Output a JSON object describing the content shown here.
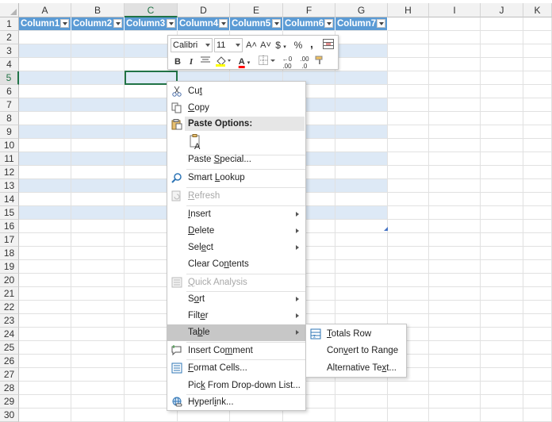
{
  "columns": [
    "A",
    "B",
    "C",
    "D",
    "E",
    "F",
    "G",
    "H",
    "I",
    "J",
    "K"
  ],
  "active_column": "C",
  "rows": [
    "1",
    "2",
    "3",
    "4",
    "5",
    "6",
    "7",
    "8",
    "9",
    "10",
    "11",
    "12",
    "13",
    "14",
    "15",
    "16",
    "17",
    "18",
    "19",
    "20",
    "21",
    "22",
    "23",
    "24",
    "25",
    "26",
    "27",
    "28",
    "29",
    "30"
  ],
  "active_row": "5",
  "table_headers": [
    "Column1",
    "Column2",
    "Column3",
    "Column4",
    "Column5",
    "Column6",
    "Column7"
  ],
  "colors": {
    "header_blue": "#5b9bd5",
    "band_blue": "#dde9f6",
    "select_green": "#217346",
    "font_red": "#ff0000",
    "highlight_yellow": "#ffff00"
  },
  "mini_toolbar": {
    "font": "Calibri",
    "size": "11",
    "grow_font": "A˄",
    "shrink_font": "A˅",
    "currency": "$",
    "percent": "%",
    "comma": ",",
    "bold": "B",
    "italic": "I",
    "font_color_letter": "A",
    "increase_decimal": ".00",
    "decrease_decimal": ".0"
  },
  "context_menu": {
    "cut": {
      "pre": "Cu",
      "acc": "t",
      "post": ""
    },
    "copy": {
      "pre": "",
      "acc": "C",
      "post": "opy"
    },
    "paste_options": "Paste Options:",
    "paste_special": {
      "pre": "Paste ",
      "acc": "S",
      "post": "pecial..."
    },
    "smart_lookup": {
      "pre": "Smart ",
      "acc": "L",
      "post": "ookup"
    },
    "refresh": {
      "pre": "",
      "acc": "R",
      "post": "efresh"
    },
    "insert": {
      "pre": "",
      "acc": "I",
      "post": "nsert"
    },
    "delete": {
      "pre": "",
      "acc": "D",
      "post": "elete"
    },
    "select": {
      "pre": "Sel",
      "acc": "e",
      "post": "ct"
    },
    "clear_contents": {
      "pre": "Clear Co",
      "acc": "n",
      "post": "tents"
    },
    "quick_analysis": {
      "pre": "",
      "acc": "Q",
      "post": "uick Analysis"
    },
    "sort": {
      "pre": "S",
      "acc": "o",
      "post": "rt"
    },
    "filter": {
      "pre": "Filt",
      "acc": "e",
      "post": "r"
    },
    "table": {
      "pre": "Ta",
      "acc": "b",
      "post": "le"
    },
    "insert_comment": {
      "pre": "Insert Co",
      "acc": "m",
      "post": "ment"
    },
    "format_cells": {
      "pre": "",
      "acc": "F",
      "post": "ormat Cells..."
    },
    "pick_list": {
      "pre": "Pic",
      "acc": "k",
      "post": " From Drop-down List..."
    },
    "hyperlink": {
      "pre": "Hyperl",
      "acc": "i",
      "post": "nk..."
    }
  },
  "submenu": {
    "totals_row": {
      "pre": "",
      "acc": "T",
      "post": "otals Row"
    },
    "convert_to_range": {
      "pre": "Con",
      "acc": "v",
      "post": "ert to Range"
    },
    "alternative_text": {
      "pre": "Alternative Te",
      "acc": "x",
      "post": "t..."
    }
  }
}
